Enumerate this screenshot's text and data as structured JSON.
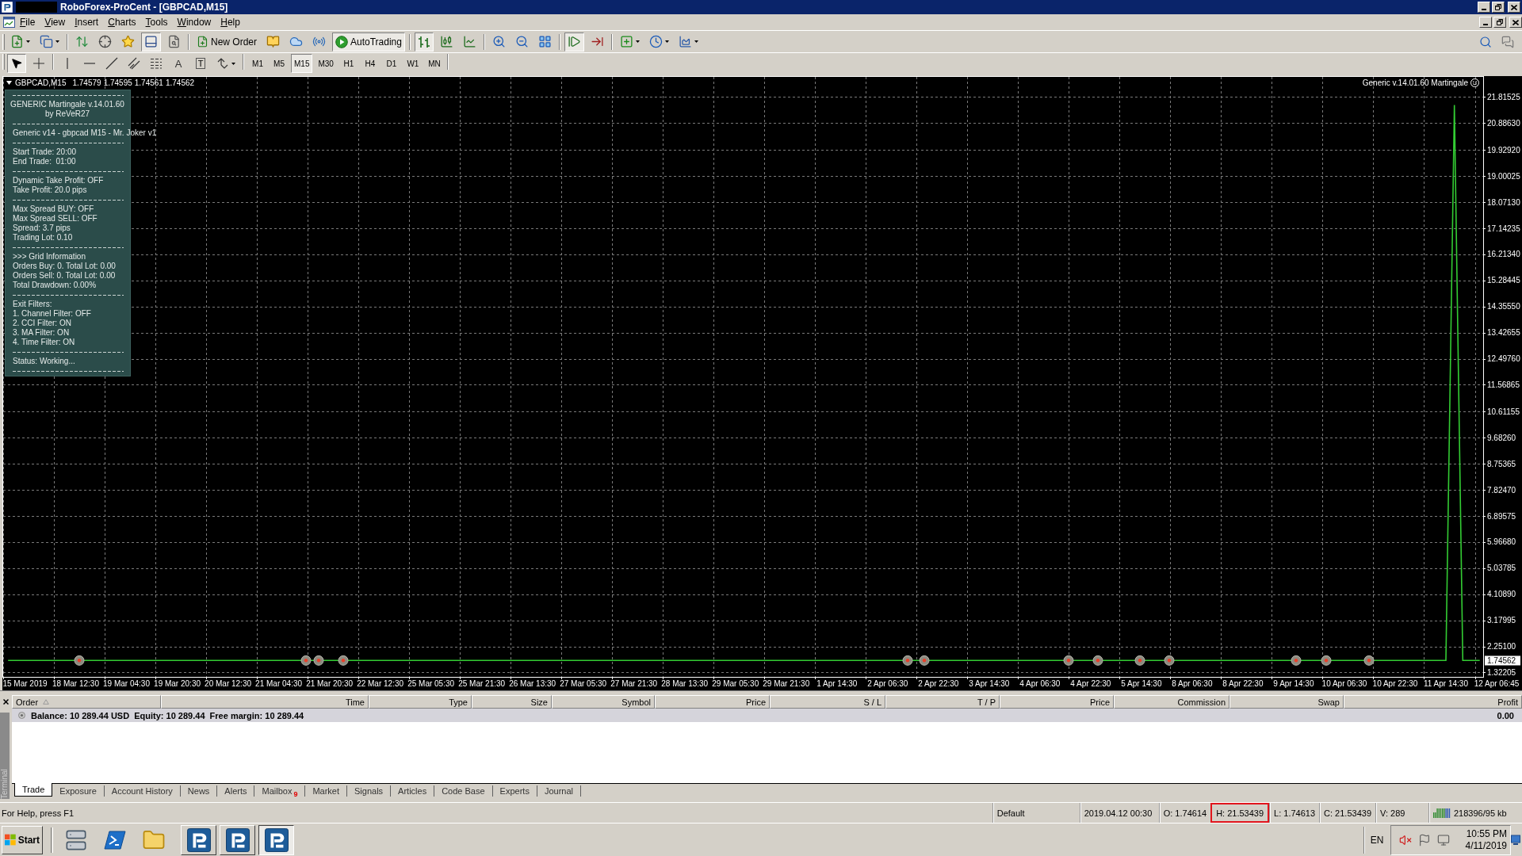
{
  "title_bar": {
    "title": "RoboForex-ProCent - [GBPCAD,M15]"
  },
  "menu": [
    "File",
    "View",
    "Insert",
    "Charts",
    "Tools",
    "Window",
    "Help"
  ],
  "main_toolbar": [
    [
      {
        "pressed": false
      },
      {
        "pressed": false
      }
    ],
    [
      {
        "pressed": false
      },
      {
        "pressed": false
      },
      {
        "pressed": false
      },
      {
        "pressed": true
      },
      {
        "pressed": false
      }
    ],
    [
      {
        "label": "New Order",
        "pressed": false
      },
      {
        "pressed": false
      },
      {
        "pressed": false
      },
      {
        "pressed": false
      },
      {
        "label": "AutoTrading",
        "pressed": true
      }
    ],
    [
      {
        "pressed": true
      },
      {
        "pressed": false
      },
      {
        "pressed": false
      }
    ],
    [
      {
        "pressed": false
      },
      {
        "pressed": false
      },
      {
        "pressed": false
      }
    ],
    [
      {
        "pressed": true
      },
      {
        "pressed": false
      }
    ],
    [
      {
        "pressed": false
      },
      {
        "pressed": false
      },
      {
        "pressed": false
      }
    ]
  ],
  "drawing_toolbar": [
    [
      {
        "pressed": true
      },
      {
        "pressed": false
      }
    ],
    [
      {
        "pressed": false
      },
      {
        "pressed": false
      },
      {
        "pressed": false
      },
      {
        "pressed": false
      },
      {
        "pressed": false
      },
      {
        "label": "A",
        "pressed": false
      },
      {
        "label": "T",
        "pressed": false
      },
      {
        "pressed": false
      }
    ]
  ],
  "timeframes": [
    {
      "label": "M1",
      "selected": false
    },
    {
      "label": "M5",
      "selected": false
    },
    {
      "label": "M15",
      "selected": true
    },
    {
      "label": "M30",
      "selected": false
    },
    {
      "label": "H1",
      "selected": false
    },
    {
      "label": "H4",
      "selected": false
    },
    {
      "label": "D1",
      "selected": false
    },
    {
      "label": "W1",
      "selected": false
    },
    {
      "label": "MN",
      "selected": false
    }
  ],
  "chart": {
    "symbol": "GBPCAD,M15",
    "quotes": [
      "1.74579",
      "1.74595",
      "1.74561",
      "1.74562"
    ],
    "expert": "Generic v.14.01.60 Martingale",
    "current_price": "1.74562",
    "chart_data": {
      "type": "line",
      "color": "#33cc33",
      "grid": true,
      "ylim": [
        1.166,
        22.563
      ],
      "yticks": [
        1.32205,
        {
          "value": 2.251,
          "label": "2.25100"
        },
        3.17995,
        {
          "value": 4.1089,
          "label": "4.10890"
        },
        5.03785,
        {
          "value": 5.9668,
          "label": "5.96680"
        },
        6.89575,
        {
          "value": 7.8247,
          "label": "7.82470"
        },
        8.75365,
        {
          "value": 9.6826,
          "label": "9.68260"
        },
        10.61155,
        11.56865,
        {
          "value": 12.4976,
          "label": "12.49760"
        },
        13.42655,
        {
          "value": 14.3555,
          "label": "14.35550"
        },
        15.28445,
        {
          "value": 16.2134,
          "label": "16.21340"
        },
        17.14235,
        {
          "value": 18.0713,
          "label": "18.07130"
        },
        19.00025,
        {
          "value": 19.9292,
          "label": "19.92920"
        },
        {
          "value": 20.8863,
          "label": "20.88630"
        },
        21.81525
      ],
      "categories": [
        null,
        null,
        "15 Mar 2019",
        null,
        null,
        null,
        null,
        null,
        "18 Mar 12:30",
        null,
        null,
        null,
        null,
        null,
        "19 Mar 04:30",
        null,
        null,
        null,
        null,
        null,
        "19 Mar 20:30",
        null,
        null,
        null,
        null,
        null,
        "20 Mar 12:30",
        null,
        null,
        null,
        null,
        null,
        "21 Mar 04:30",
        null,
        null,
        null,
        null,
        null,
        "21 Mar 20:30",
        null,
        null,
        null,
        null,
        null,
        "22 Mar 12:30",
        null,
        null,
        null,
        null,
        null,
        "25 Mar 05:30",
        null,
        null,
        null,
        null,
        null,
        "25 Mar 21:30",
        null,
        null,
        null,
        null,
        null,
        "26 Mar 13:30",
        null,
        null,
        null,
        null,
        null,
        "27 Mar 05:30",
        null,
        null,
        null,
        null,
        null,
        "27 Mar 21:30",
        null,
        null,
        null,
        null,
        null,
        "28 Mar 13:30",
        null,
        null,
        null,
        null,
        null,
        "29 Mar 05:30",
        null,
        null,
        null,
        null,
        null,
        "29 Mar 21:30",
        null,
        null,
        null,
        null,
        null,
        "1 Apr 14:30",
        null,
        null,
        null,
        null,
        null,
        "2 Apr 06:30",
        null,
        null,
        null,
        null,
        null,
        "2 Apr 22:30",
        null,
        null,
        null,
        null,
        null,
        "3 Apr 14:30",
        null,
        null,
        null,
        null,
        null,
        "4 Apr 06:30",
        null,
        null,
        null,
        null,
        null,
        "4 Apr 22:30",
        null,
        null,
        null,
        null,
        null,
        "5 Apr 14:30",
        null,
        null,
        null,
        null,
        null,
        "8 Apr 06:30",
        null,
        null,
        null,
        null,
        null,
        "8 Apr 22:30",
        null,
        null,
        null,
        null,
        null,
        "9 Apr 14:30",
        null,
        null,
        null,
        null,
        null,
        "10 Apr 06:30",
        null,
        null,
        null,
        null,
        null,
        "10 Apr 22:30",
        null,
        null,
        null,
        null,
        null,
        "11 Apr 14:30",
        null,
        null,
        null,
        null,
        null,
        "12 Apr 06:45"
      ],
      "values": [
        1.75,
        1.75,
        1.75,
        1.75,
        1.75,
        1.75,
        1.75,
        1.75,
        1.75,
        1.75,
        1.75,
        1.75,
        1.75,
        1.75,
        1.75,
        1.75,
        1.75,
        1.75,
        1.75,
        1.75,
        1.75,
        1.75,
        1.75,
        1.75,
        1.75,
        1.75,
        1.75,
        1.75,
        1.75,
        1.75,
        1.75,
        1.75,
        1.75,
        1.75,
        1.75,
        1.75,
        1.75,
        1.75,
        1.75,
        1.75,
        1.75,
        1.75,
        1.75,
        1.75,
        1.75,
        1.75,
        1.75,
        1.75,
        1.75,
        1.75,
        1.75,
        1.75,
        1.75,
        1.75,
        1.75,
        1.75,
        1.75,
        1.75,
        1.75,
        1.75,
        1.75,
        1.75,
        1.75,
        1.75,
        1.75,
        1.75,
        1.75,
        1.75,
        1.75,
        1.75,
        1.75,
        1.75,
        1.75,
        1.75,
        1.75,
        1.75,
        1.75,
        1.75,
        1.75,
        1.75,
        1.75,
        1.75,
        1.75,
        1.75,
        1.75,
        1.75,
        1.75,
        1.75,
        1.75,
        1.75,
        1.75,
        1.75,
        1.75,
        1.75,
        1.75,
        1.75,
        1.75,
        1.75,
        1.75,
        1.75,
        1.75,
        1.75,
        1.75,
        1.75,
        1.75,
        1.75,
        1.75,
        1.75,
        1.75,
        1.75,
        1.75,
        1.75,
        1.75,
        1.75,
        1.75,
        1.75,
        1.75,
        1.75,
        1.75,
        1.75,
        1.75,
        1.75,
        1.75,
        1.75,
        1.75,
        1.75,
        1.75,
        1.75,
        1.75,
        1.75,
        1.75,
        1.75,
        1.75,
        1.75,
        1.75,
        1.75,
        1.75,
        1.75,
        1.75,
        1.75,
        1.75,
        1.75,
        1.75,
        1.75,
        1.75,
        1.75,
        1.75,
        1.75,
        1.75,
        1.75,
        1.75,
        1.75,
        1.75,
        1.75,
        1.75,
        1.75,
        1.75,
        1.75,
        1.75,
        1.75,
        1.75,
        1.75,
        1.75,
        1.75,
        1.75,
        1.75,
        1.75,
        1.75,
        1.75,
        1.75,
        1.75,
        21.53,
        1.75,
        1.75,
        1.75,
        null,
        null
      ]
    }
  },
  "info_panel": {
    "title": "GENERIC Martingale v.14.01.60",
    "author": "by ReVeR27",
    "sections": [
      [
        "Generic v14 - gbpcad M15 - Mr. Joker v1"
      ],
      [
        "Start Trade: 20:00",
        "End Trade:  01:00"
      ],
      [
        "Dynamic Take Profit: OFF",
        "Take Profit: 20.0 pips"
      ],
      [
        "Max Spread BUY: OFF",
        "Max Spread SELL: OFF",
        "Spread: 3.7 pips",
        "Trading Lot: 0.10"
      ],
      [
        ">>> Grid Information",
        "Orders Buy: 0. Total Lot: 0.00",
        "Orders Sell: 0. Total Lot: 0.00",
        "Total Drawdown: 0.00%"
      ],
      [
        "Exit Filters:",
        "1. Channel Filter: OFF",
        "2. CCI Filter: ON",
        "3. MA Filter: ON",
        "4. Time Filter: ON"
      ],
      [
        "Status: Working..."
      ]
    ]
  },
  "terminal": {
    "title": "Terminal",
    "columns": [
      {
        "label": "Order",
        "sorted": true
      },
      {
        "label": "Time",
        "sorted": false
      },
      {
        "label": "Type",
        "sorted": false
      },
      {
        "label": "Size",
        "sorted": false
      },
      {
        "label": "Symbol",
        "sorted": false
      },
      {
        "label": "Price",
        "sorted": false
      },
      {
        "label": "S / L",
        "sorted": false
      },
      {
        "label": "T / P",
        "sorted": false
      },
      {
        "label": "Price",
        "sorted": false
      },
      {
        "label": "Commission",
        "sorted": false
      },
      {
        "label": "Swap",
        "sorted": false
      },
      {
        "label": "Profit",
        "sorted": false
      }
    ],
    "balance": "Balance: 10 289.44 USD  Equity: 10 289.44  Free margin: 10 289.44",
    "profit": "0.00",
    "tabs": [
      {
        "label": "Trade",
        "selected": true
      },
      {
        "label": "Exposure",
        "selected": false
      },
      {
        "label": "Account History",
        "selected": false
      },
      {
        "label": "News",
        "selected": false
      },
      {
        "label": "Alerts",
        "selected": false
      },
      {
        "label": "Mailbox",
        "selected": false,
        "badge": "9"
      },
      {
        "label": "Market",
        "selected": false
      },
      {
        "label": "Signals",
        "selected": false
      },
      {
        "label": "Articles",
        "selected": false
      },
      {
        "label": "Code Base",
        "selected": false
      },
      {
        "label": "Experts",
        "selected": false
      },
      {
        "label": "Journal",
        "selected": false
      }
    ]
  },
  "status_bar": {
    "help": "For Help, press F1",
    "items": [
      {
        "kind": "profile",
        "text": "Default",
        "highlighted": false
      },
      {
        "kind": "time",
        "text": "2019.04.12 00:30",
        "highlighted": false
      },
      {
        "kind": "price",
        "text": "O: 1.74614",
        "highlighted": false
      },
      {
        "kind": "price",
        "text": "H: 21.53439",
        "highlighted": true
      },
      {
        "kind": "price",
        "text": "L: 1.74613",
        "highlighted": false
      },
      {
        "kind": "price",
        "text": "C: 21.53439",
        "highlighted": false
      },
      {
        "kind": "volume",
        "text": "V: 289",
        "highlighted": false
      },
      {
        "kind": "connection",
        "text": "218396/95 kb",
        "highlighted": false
      }
    ]
  },
  "taskbar": {
    "start": "Start",
    "tasks": [
      {
        "active": false
      },
      {
        "active": false
      },
      {
        "active": true
      }
    ],
    "language": "EN",
    "time": "10:55 PM",
    "date": "4/11/2019"
  }
}
